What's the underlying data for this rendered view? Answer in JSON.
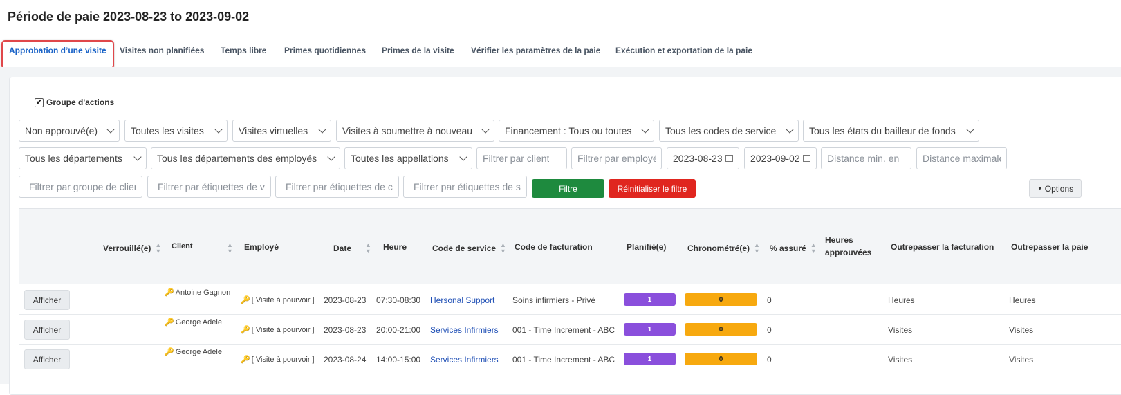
{
  "page": {
    "title": "Période de paie 2023-08-23 to 2023-09-02"
  },
  "tabs": [
    {
      "label": "Approbation d’une visite",
      "active": true
    },
    {
      "label": "Visites non planifiées"
    },
    {
      "label": "Temps libre"
    },
    {
      "label": "Primes quotidiennes"
    },
    {
      "label": "Primes de la visite"
    },
    {
      "label": "Vérifier les paramètres de la paie"
    },
    {
      "label": "Exécution et exportation de la paie"
    }
  ],
  "group_actions": {
    "label": "Groupe d'actions",
    "checked": true
  },
  "filters": {
    "row1": [
      "Non approuvé(e)",
      "Toutes les visites",
      "Visites virtuelles",
      "Visites à soumettre à nouveau",
      "Financement : Tous ou toutes",
      "Tous les codes de service",
      "Tous les états du bailleur de fonds"
    ],
    "row2_selects": [
      "Tous les départements",
      "Tous les départements des employés",
      "Toutes les appellations"
    ],
    "client_placeholder": "Filtrer par client",
    "employee_placeholder": "Filtrer par employé",
    "start_date": "2023-08-23",
    "end_date": "2023-09-02",
    "distance_min_placeholder": "Distance min. en",
    "distance_max_placeholder": "Distance maximale",
    "row3_inputs": [
      "Filtrer par groupe de client",
      "Filtrer par étiquettes de visite",
      "Filtrer par étiquettes de client",
      "Filtrer par étiquettes de service"
    ],
    "filter_button": "Filtre",
    "reset_button": "Réinitialiser le filtre",
    "options_button": "Options"
  },
  "table": {
    "headers": {
      "locked": "Verrouillé(e)",
      "client": "Client",
      "employee": "Employé",
      "date": "Date",
      "time": "Heure",
      "service_code": "Code de service",
      "billing_code": "Code de facturation",
      "planned": "Planifié(e)",
      "timed": "Chronométré(e)",
      "insured": "% assuré",
      "approved_hours_1": "Heures",
      "approved_hours_2": "approuvées",
      "billing_override": "Outrepasser la facturation",
      "pay_override": "Outrepasser la paie"
    },
    "rows": [
      {
        "action": "Afficher",
        "client": "Antoine Gagnon",
        "employee": "[ Visite à pourvoir ]",
        "date": "2023-08-23",
        "time": "07:30-08:30",
        "service_code": "Hersonal Support",
        "billing_code": "Soins infirmiers - Privé",
        "planned": "1",
        "timed": "0",
        "insured": "0",
        "billing_override": "Heures",
        "pay_override": "Heures"
      },
      {
        "action": "Afficher",
        "client": "George Adele",
        "employee": "[ Visite à pourvoir ]",
        "date": "2023-08-23",
        "time": "20:00-21:00",
        "service_code": "Services Infirmiers",
        "billing_code": "001 - Time Increment - ABC",
        "planned": "1",
        "timed": "0",
        "insured": "0",
        "billing_override": "Visites",
        "pay_override": "Visites"
      },
      {
        "action": "Afficher",
        "client": "George Adele",
        "employee": "[ Visite à pourvoir ]",
        "date": "2023-08-24",
        "time": "14:00-15:00",
        "service_code": "Services Infirmiers",
        "billing_code": "001 - Time Increment - ABC",
        "planned": "1",
        "timed": "0",
        "insured": "0",
        "billing_override": "Visites",
        "pay_override": "Visites"
      }
    ]
  }
}
